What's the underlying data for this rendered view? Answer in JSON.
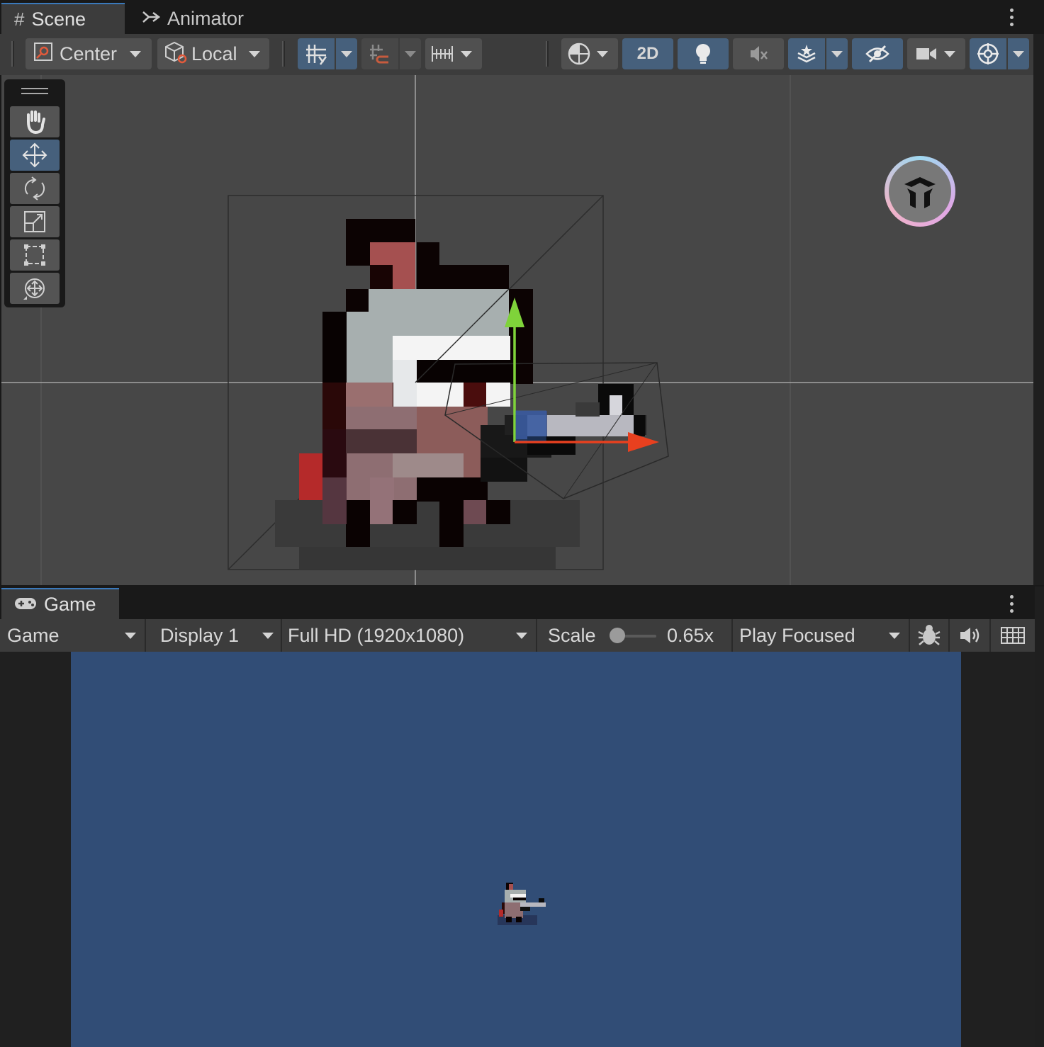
{
  "scene_tabs": [
    {
      "label": "Scene",
      "icon": "grid-icon",
      "active": true
    },
    {
      "label": "Animator",
      "icon": "animator-icon",
      "active": false
    }
  ],
  "scene_toolbar": {
    "pivot_label": "Center",
    "space_label": "Local",
    "mode_2d_label": "2D"
  },
  "tools": [
    "hand-tool",
    "move-tool",
    "rotate-tool",
    "scale-tool",
    "rect-tool",
    "transform-tool"
  ],
  "game_tab": {
    "label": "Game",
    "icon": "gamepad-icon"
  },
  "game_toolbar": {
    "view_select": "Game",
    "display_select": "Display 1",
    "resolution_select": "Full HD (1920x1080)",
    "scale_label": "Scale",
    "scale_value": "0.65x",
    "scale_slider_fraction": 0.0,
    "play_mode_select": "Play Focused"
  },
  "colors": {
    "panel_bg": "#3c3c3c",
    "tab_accent": "#3a79bb",
    "selected_button": "#46607c",
    "scene_bg": "#474747",
    "game_bg": "#314d76",
    "gizmo_x": "#e8401f",
    "gizmo_y": "#7fd33a"
  }
}
